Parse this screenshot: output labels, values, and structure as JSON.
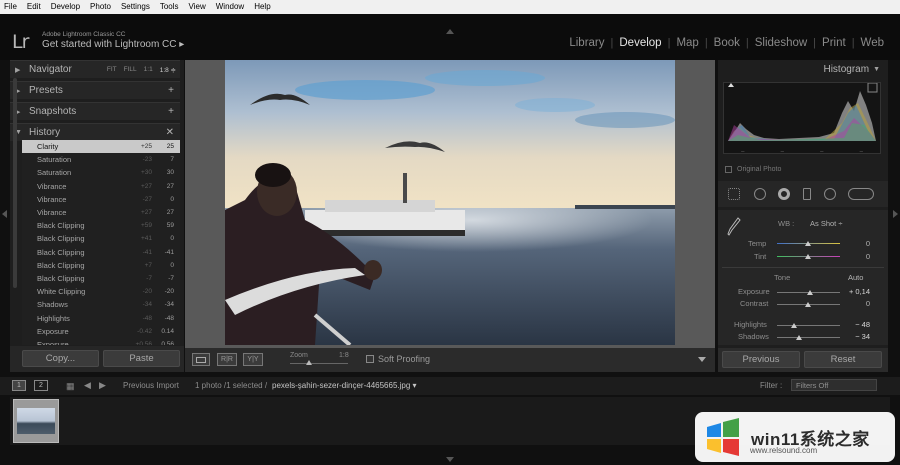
{
  "menu": [
    "File",
    "Edit",
    "Develop",
    "Photo",
    "Settings",
    "Tools",
    "View",
    "Window",
    "Help"
  ],
  "identity": {
    "logo": "Lr",
    "app_name": "Adobe Lightroom Classic CC",
    "get_started": "Get started with Lightroom CC",
    "get_started_arrow": "▸"
  },
  "modules": [
    "Library",
    "Develop",
    "Map",
    "Book",
    "Slideshow",
    "Print",
    "Web"
  ],
  "active_module": "Develop",
  "left": {
    "navigator": {
      "title": "Navigator",
      "fit": "FIT",
      "fill": "FILL",
      "one_to_one": "1:1",
      "zoom": "1:8 ≑"
    },
    "presets": {
      "title": "Presets",
      "ctl": "+"
    },
    "snapshots": {
      "title": "Snapshots",
      "ctl": "+"
    },
    "history": {
      "title": "History",
      "ctl": "✕"
    },
    "history_items": [
      {
        "name": "Clarity",
        "delta": "+25",
        "value": "25",
        "selected": true
      },
      {
        "name": "Saturation",
        "delta": "-23",
        "value": "7"
      },
      {
        "name": "Saturation",
        "delta": "+30",
        "value": "30"
      },
      {
        "name": "Vibrance",
        "delta": "+27",
        "value": "27"
      },
      {
        "name": "Vibrance",
        "delta": "-27",
        "value": "0"
      },
      {
        "name": "Vibrance",
        "delta": "+27",
        "value": "27"
      },
      {
        "name": "Black Clipping",
        "delta": "+59",
        "value": "59"
      },
      {
        "name": "Black Clipping",
        "delta": "+41",
        "value": "0"
      },
      {
        "name": "Black Clipping",
        "delta": "-41",
        "value": "-41"
      },
      {
        "name": "Black Clipping",
        "delta": "+7",
        "value": "0"
      },
      {
        "name": "Black Clipping",
        "delta": "-7",
        "value": "-7"
      },
      {
        "name": "White Clipping",
        "delta": "-20",
        "value": "-20"
      },
      {
        "name": "Shadows",
        "delta": "-34",
        "value": "-34"
      },
      {
        "name": "Highlights",
        "delta": "-48",
        "value": "-48"
      },
      {
        "name": "Exposure",
        "delta": "-0.42",
        "value": "0.14"
      },
      {
        "name": "Exposure",
        "delta": "+0.56",
        "value": "0.56"
      }
    ],
    "copy_label": "Copy...",
    "paste_label": "Paste"
  },
  "toolbar": {
    "zoom_label": "Zoom",
    "zoom_value": "1:8",
    "soft_proofing_label": "Soft Proofing",
    "before_after_1": "R|R",
    "before_after_2": "Y|Y"
  },
  "right": {
    "histogram_title": "Histogram",
    "original_photo_label": "Original Photo",
    "wb_label": "WB :",
    "wb_value": "As Shot ÷",
    "temp_label": "Temp",
    "temp_value": "0",
    "tint_label": "Tint",
    "tint_value": "0",
    "tone_label": "Tone",
    "auto_label": "Auto",
    "exposure_label": "Exposure",
    "exposure_value": "+ 0,14",
    "contrast_label": "Contrast",
    "contrast_value": "0",
    "highlights_label": "Highlights",
    "highlights_value": "− 48",
    "shadows_label": "Shadows",
    "shadows_value": "− 34",
    "previous_label": "Previous",
    "reset_label": "Reset"
  },
  "filmstrip": {
    "page1": "1",
    "page2": "2",
    "previous_import": "Previous Import",
    "count": "1 photo /1 selected /",
    "filename": "pexels-şahin-sezer-dinçer-4465665.jpg ▾",
    "filter_label": "Filter :",
    "filter_value": "Filters Off"
  },
  "watermark": {
    "text": "win11系统之家",
    "url": "www.relsound.com"
  },
  "colors": {
    "accent": "#e6e6e6",
    "panel": "#1e1e1e",
    "toolbar": "#2b2b2b",
    "selected_row": "#c9c9c9"
  }
}
